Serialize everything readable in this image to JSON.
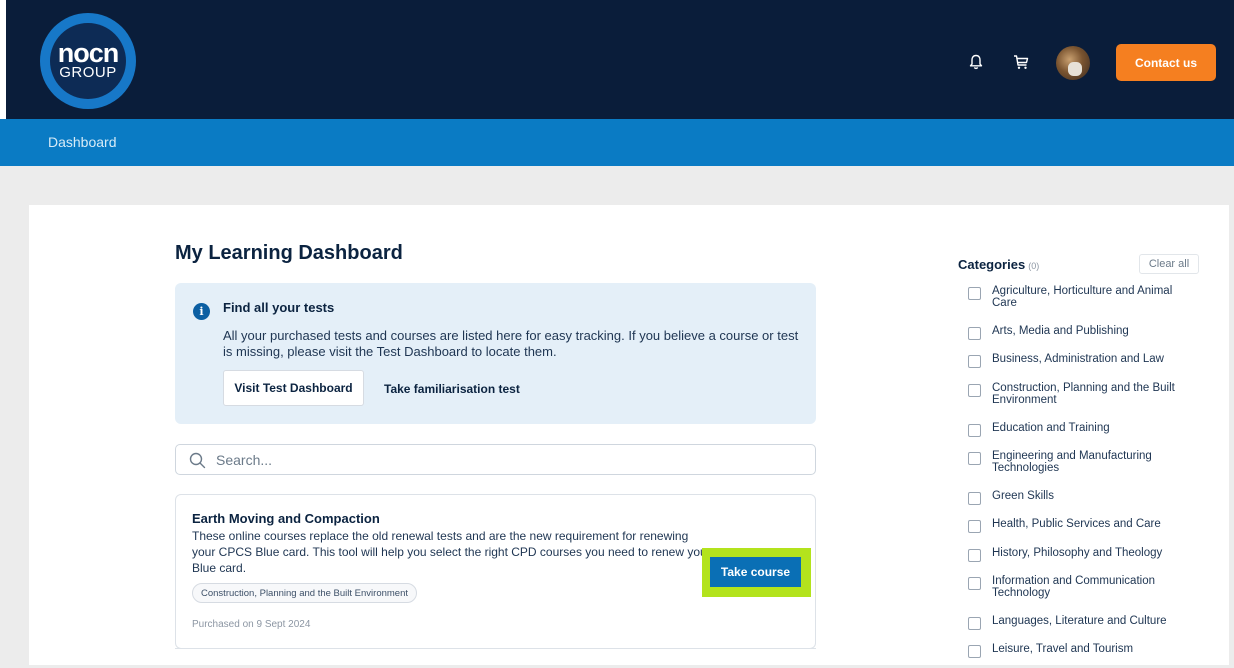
{
  "header": {
    "logo_main": "nocn",
    "logo_sub": "GROUP",
    "contact_label": "Contact us",
    "icons": [
      "bell-icon",
      "cart-icon",
      "avatar"
    ]
  },
  "nav": {
    "items": [
      {
        "label": "Dashboard"
      }
    ]
  },
  "main": {
    "title": "My Learning Dashboard",
    "info": {
      "title": "Find all your tests",
      "text": "All your purchased tests and courses are listed here for easy tracking. If you believe a course or test is missing, please visit the Test Dashboard to locate them.",
      "primary_button": "Visit Test Dashboard",
      "secondary_link": "Take familiarisation test"
    },
    "search": {
      "placeholder": "Search..."
    },
    "courses": [
      {
        "title": "Earth Moving and Compaction",
        "description": "These online courses replace the old renewal tests and are the new requirement for renewing your CPCS Blue card. This tool will help you select the right CPD courses you need to renew your Blue card.",
        "tag": "Construction, Planning and the Built Environment",
        "purchased": "Purchased on 9 Sept 2024",
        "action": "Take course"
      }
    ]
  },
  "sidebar": {
    "title": "Categories",
    "count": "(0)",
    "clear_label": "Clear all",
    "categories": [
      {
        "label": "Agriculture, Horticulture and Animal Care"
      },
      {
        "label": "Arts, Media and Publishing"
      },
      {
        "label": "Business, Administration and Law"
      },
      {
        "label": "Construction, Planning and the Built Environment"
      },
      {
        "label": "Education and Training"
      },
      {
        "label": "Engineering and Manufacturing Technologies"
      },
      {
        "label": "Green Skills"
      },
      {
        "label": "Health, Public Services and Care"
      },
      {
        "label": "History, Philosophy and Theology"
      },
      {
        "label": "Information and Communication Technology"
      },
      {
        "label": "Languages, Literature and Culture"
      },
      {
        "label": "Leisure, Travel and Tourism"
      }
    ]
  },
  "colors": {
    "header_bg": "#0a1d3a",
    "nav_bg": "#0a7bc4",
    "accent_orange": "#f57f20",
    "button_blue": "#0a6fb5",
    "highlight_green": "#b3e31d"
  }
}
